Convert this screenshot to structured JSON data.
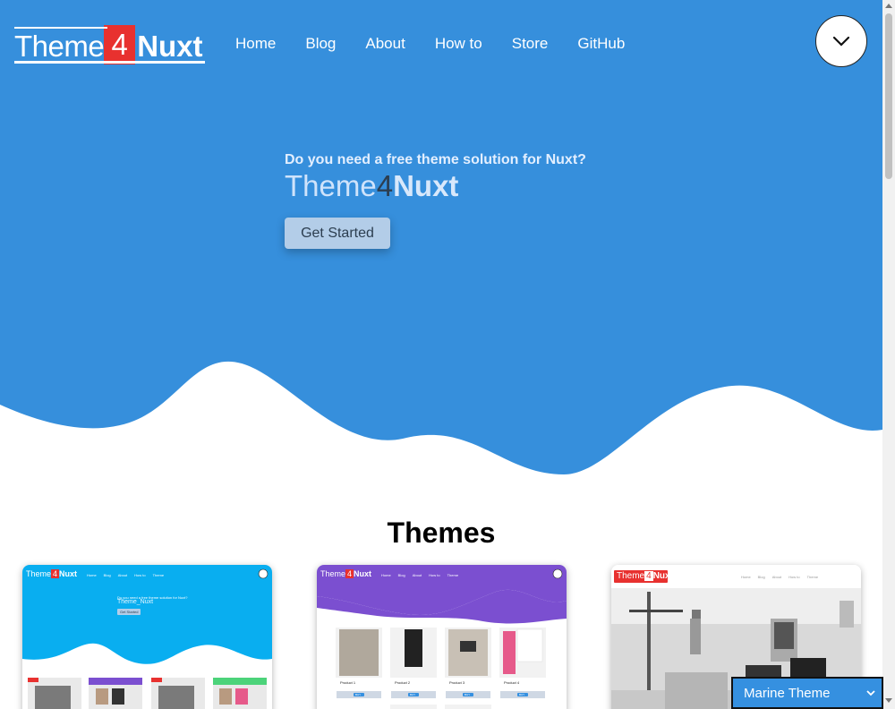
{
  "colors": {
    "primary": "#368fdc",
    "logo_four_bg": "#e8312f",
    "button_bg": "#b3cde8",
    "card1": "#09aef0",
    "card2": "#7b4fd0"
  },
  "header": {
    "logo": {
      "theme": "Theme",
      "four": "4",
      "nuxt": "Nuxt"
    },
    "nav": [
      "Home",
      "Blog",
      "About",
      "How to",
      "Store",
      "GitHub"
    ],
    "menu_icon": "chevron-down-icon"
  },
  "hero": {
    "question": "Do you need a free theme solution for Nuxt?",
    "title": {
      "theme": "Theme",
      "four": "4",
      "nuxt": "Nuxt"
    },
    "cta": "Get Started"
  },
  "themes": {
    "heading": "Themes",
    "cards": [
      {
        "name": "Marine theme preview",
        "mini_nav": [
          "Home",
          "Blog",
          "About",
          "How to",
          "Theme"
        ],
        "question": "Do you need a free theme solution for Nuxt?",
        "title": "Theme_Nuxt",
        "cta": "Get Started"
      },
      {
        "name": "Purple theme preview",
        "mini_nav": [
          "Home",
          "Blog",
          "About",
          "How to",
          "Theme"
        ],
        "products": [
          "Product 1",
          "Product 2",
          "Product 3",
          "Product 4"
        ],
        "buy": "BUY"
      },
      {
        "name": "Monochrome theme preview",
        "mini_nav": [
          "Home",
          "Blog",
          "About",
          "How to",
          "Theme"
        ]
      }
    ]
  },
  "theme_select": {
    "selected": "Marine Theme"
  }
}
